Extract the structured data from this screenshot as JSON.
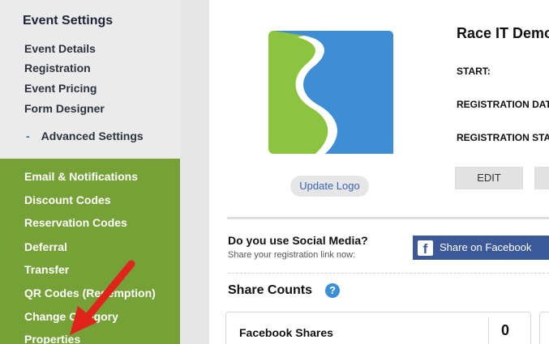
{
  "sidebar": {
    "title": "Event Settings",
    "items": [
      "Event Details",
      "Registration",
      "Event Pricing",
      "Form Designer"
    ],
    "advanced": {
      "dash": "-",
      "label": "Advanced Settings"
    },
    "advanced_items": [
      "Email & Notifications",
      "Discount Codes",
      "Reservation Codes",
      "Deferral",
      "Transfer",
      "QR Codes (Redemption)",
      "Change Category",
      "Properties"
    ]
  },
  "event": {
    "update_logo_label": "Update Logo",
    "title": "Race IT Demo",
    "start_label": "START:",
    "reg_date_label": "REGISTRATION DATES:",
    "reg_status_label": "REGISTRATION STATUS:",
    "edit_label": "EDIT"
  },
  "social": {
    "question": "Do you use Social Media?",
    "subtitle": "Share your registration link now:",
    "facebook_button": "Share on Facebook",
    "facebook_glyph": "f"
  },
  "share_counts": {
    "title": "Share Counts",
    "help_glyph": "?",
    "facebook_label": "Facebook Shares",
    "facebook_value": "0"
  },
  "colors": {
    "sidebar_green": "#76a136",
    "logo_blue": "#3f8ed4",
    "logo_green": "#8dc43f",
    "facebook_blue": "#3b5998",
    "arrow_red": "#e0231b"
  }
}
